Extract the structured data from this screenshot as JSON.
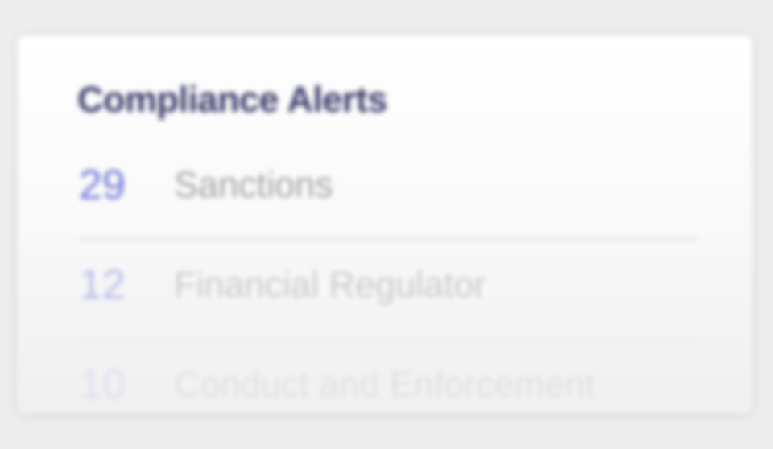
{
  "widget": {
    "title": "Compliance Alerts"
  },
  "alerts": [
    {
      "count": "29",
      "label": "Sanctions"
    },
    {
      "count": "12",
      "label": "Financial Regulator"
    },
    {
      "count": "10",
      "label": "Conduct and Enforcement"
    }
  ],
  "colors": {
    "title": "#3b3d6b",
    "accent": "#6f74d6",
    "label": "#a3a3a5",
    "background": "#ededed",
    "card": "#ffffff"
  }
}
